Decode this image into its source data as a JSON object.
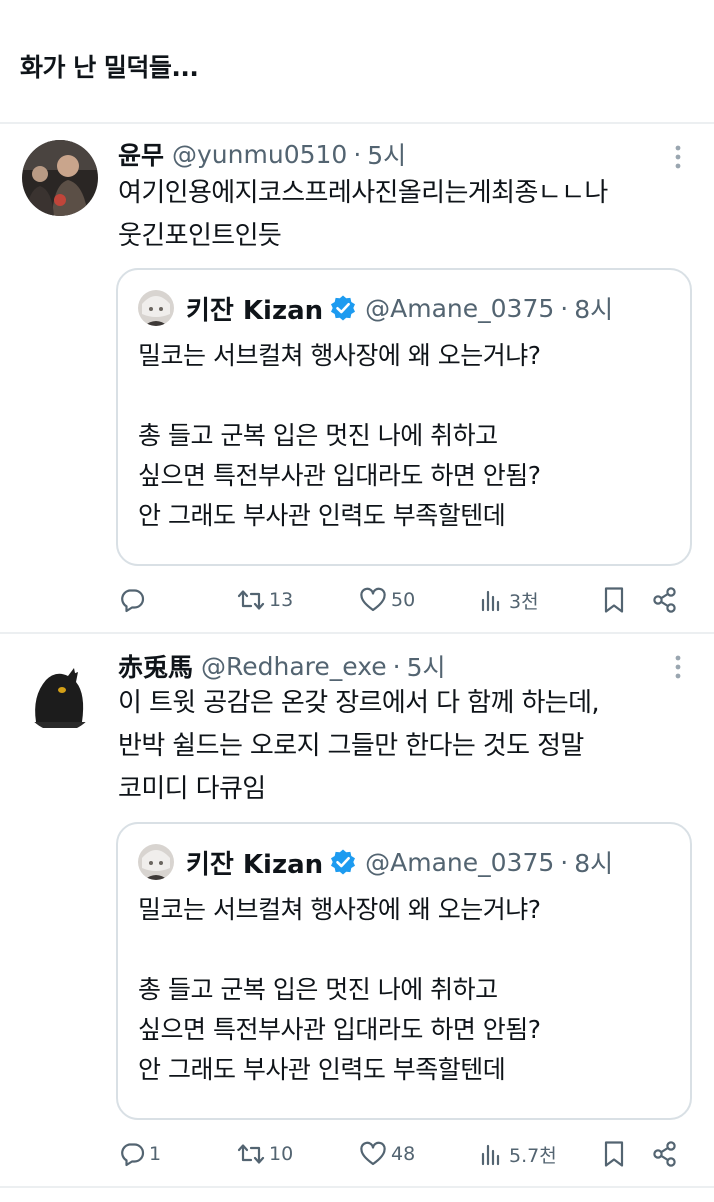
{
  "post": {
    "title": "화가 난 밀덕들..."
  },
  "tweets": [
    {
      "name": "윤무",
      "handle": "@yunmu0510",
      "sep": "·",
      "time": "5시",
      "lines": [
        "여기인용에지코스프레사진올리는게최종ㄴㄴ나",
        "웃긴포인트인듯"
      ],
      "quote": {
        "name": "키잔 Kizan",
        "handle": "@Amane_0375",
        "sep": "·",
        "time": "8시",
        "lines": [
          "밀코는 서브컬쳐 행사장에 왜 오는거냐?",
          "총 들고 군복 입은 멋진 나에 취하고",
          "싶으면 특전부사관 입대라도 하면 안됨?",
          "안 그래도 부사관 인력도 부족할텐데"
        ]
      },
      "stats": {
        "replies": "",
        "retweets": "13",
        "likes": "50",
        "views": "3천"
      }
    },
    {
      "name": "赤兎馬",
      "handle": "@Redhare_exe",
      "sep": "·",
      "time": "5시",
      "lines": [
        "이 트윗 공감은 온갖 장르에서 다 함께 하는데,",
        "반박 쉴드는 오로지 그들만 한다는 것도 정말",
        "코미디 다큐임"
      ],
      "quote": {
        "name": "키잔 Kizan",
        "handle": "@Amane_0375",
        "sep": "·",
        "time": "8시",
        "lines": [
          "밀코는 서브컬쳐 행사장에 왜 오는거냐?",
          "총 들고 군복 입은 멋진 나에 취하고",
          "싶으면 특전부사관 입대라도 하면 안됨?",
          "안 그래도 부사관 인력도 부족할텐데"
        ]
      },
      "stats": {
        "replies": "1",
        "retweets": "10",
        "likes": "48",
        "views": "5.7천"
      }
    }
  ],
  "icons": {
    "reply": "reply-icon",
    "retweet": "retweet-icon",
    "like": "heart-icon",
    "views": "views-icon",
    "bookmark": "bookmark-icon",
    "share": "share-icon",
    "more": "more-icon",
    "verified": "verified-badge-icon"
  },
  "colors": {
    "text": "#0f1419",
    "secondary": "#536471",
    "verified": "#1d9bf0",
    "border": "#d9e0e5"
  }
}
